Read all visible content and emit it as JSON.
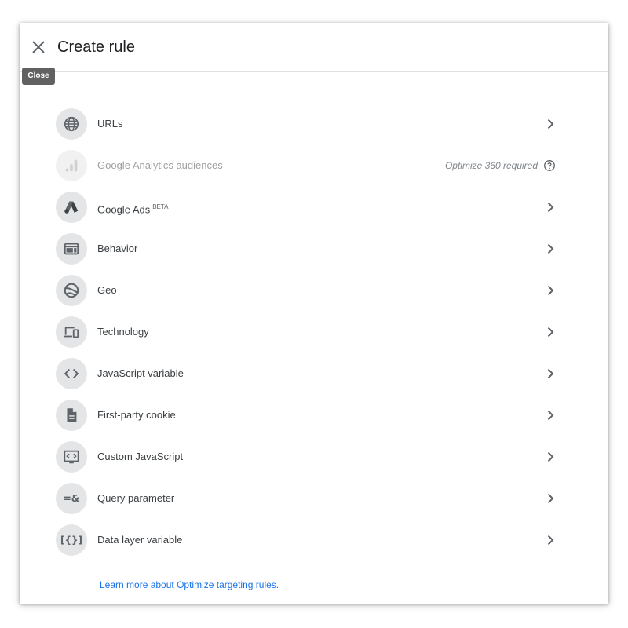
{
  "dialog": {
    "title": "Create rule",
    "close_tooltip": "Close",
    "footer_link": "Learn more about Optimize targeting rules."
  },
  "rules": [
    {
      "label": "URLs",
      "icon": "globe-icon"
    },
    {
      "label": "Google Analytics audiences",
      "icon": "analytics-icon",
      "note": "Optimize 360 required",
      "disabled": true
    },
    {
      "label": "Google Ads",
      "badge": "BETA",
      "icon": "google-ads-icon"
    },
    {
      "label": "Behavior",
      "icon": "web-layout-icon"
    },
    {
      "label": "Geo",
      "icon": "earth-icon"
    },
    {
      "label": "Technology",
      "icon": "devices-icon"
    },
    {
      "label": "JavaScript variable",
      "icon": "code-icon"
    },
    {
      "label": "First-party cookie",
      "icon": "document-icon"
    },
    {
      "label": "Custom JavaScript",
      "icon": "settings-ethernet-icon"
    },
    {
      "label": "Query parameter",
      "icon": "query-parameter-icon",
      "icon_text": "=&"
    },
    {
      "label": "Data layer variable",
      "icon": "data-layer-icon",
      "icon_text": "[{}]"
    }
  ],
  "colors": {
    "accent_link": "#1a73e8",
    "icon_bg": "#e4e5e7",
    "icon_fg": "#5f6368",
    "disabled_text": "#a0a0a0"
  }
}
